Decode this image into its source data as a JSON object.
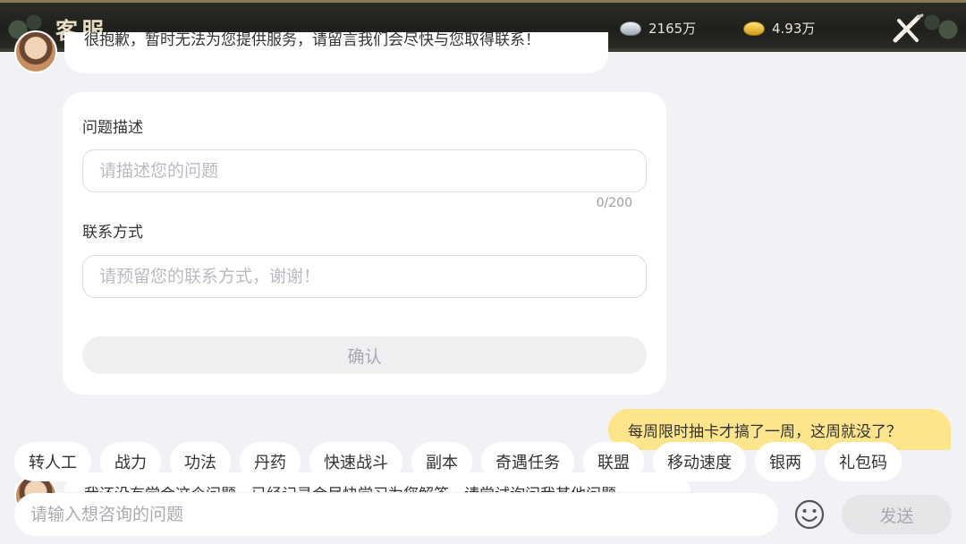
{
  "header": {
    "title": "客服",
    "silver": {
      "icon": "silver-ingot-icon",
      "amount": "2165万"
    },
    "gold": {
      "icon": "gold-ingot-icon",
      "amount": "4.93万"
    },
    "close_icon": "close-x-icon"
  },
  "chat": {
    "agent_message_top": "很抱歉，暂时无法为您提供服务，请留言我们会尽快与您取得联系！",
    "form": {
      "description_label": "问题描述",
      "description_placeholder": "请描述您的问题",
      "counter": "0/200",
      "contact_label": "联系方式",
      "contact_placeholder": "请预留您的联系方式，谢谢！",
      "confirm_label": "确认"
    },
    "user_message": "每周限时抽卡才搞了一周，这周就没了？",
    "agent_message_bottom": "我还没有学会这个问题，已经记录会尽快学习为您解答，请尝试询问我其他问题"
  },
  "quick_replies": [
    "转人工",
    "战力",
    "功法",
    "丹药",
    "快速战斗",
    "副本",
    "奇遇任务",
    "联盟",
    "移动速度",
    "银两",
    "礼包码"
  ],
  "composer": {
    "placeholder": "请输入想咨询的问题",
    "emoji_icon": "emoji-smile-icon",
    "send_label": "发送"
  },
  "colors": {
    "user_bubble": "#fde58c",
    "background": "#f1f2f5"
  }
}
